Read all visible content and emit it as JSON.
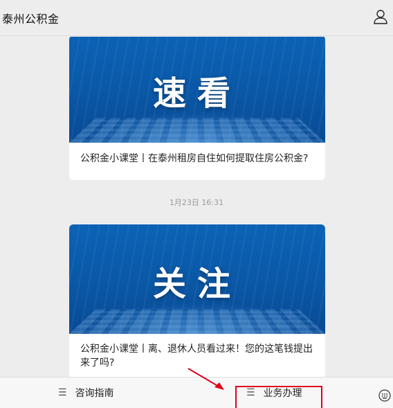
{
  "header": {
    "title": "泰州公积金",
    "profile_icon": "person-icon"
  },
  "messages": [
    {
      "banner_text": "速看",
      "caption": "公积金小课堂丨在泰州租房自住如何提取住房公积金?"
    },
    {
      "timestamp": "1月23日 16:31",
      "banner_text": "关注",
      "caption": "公积金小课堂丨离、退休人员看过来！您的这笔钱提出来了吗?"
    }
  ],
  "bottom_menu": {
    "items": [
      {
        "icon": "menu-lines-icon",
        "label": "咨询指南"
      },
      {
        "icon": "menu-lines-icon",
        "label": "业务办理"
      }
    ],
    "keyboard_icon": "keyboard-icon"
  },
  "annotation": {
    "highlight_color": "#e0001a",
    "arrow_color": "#e0001a"
  }
}
